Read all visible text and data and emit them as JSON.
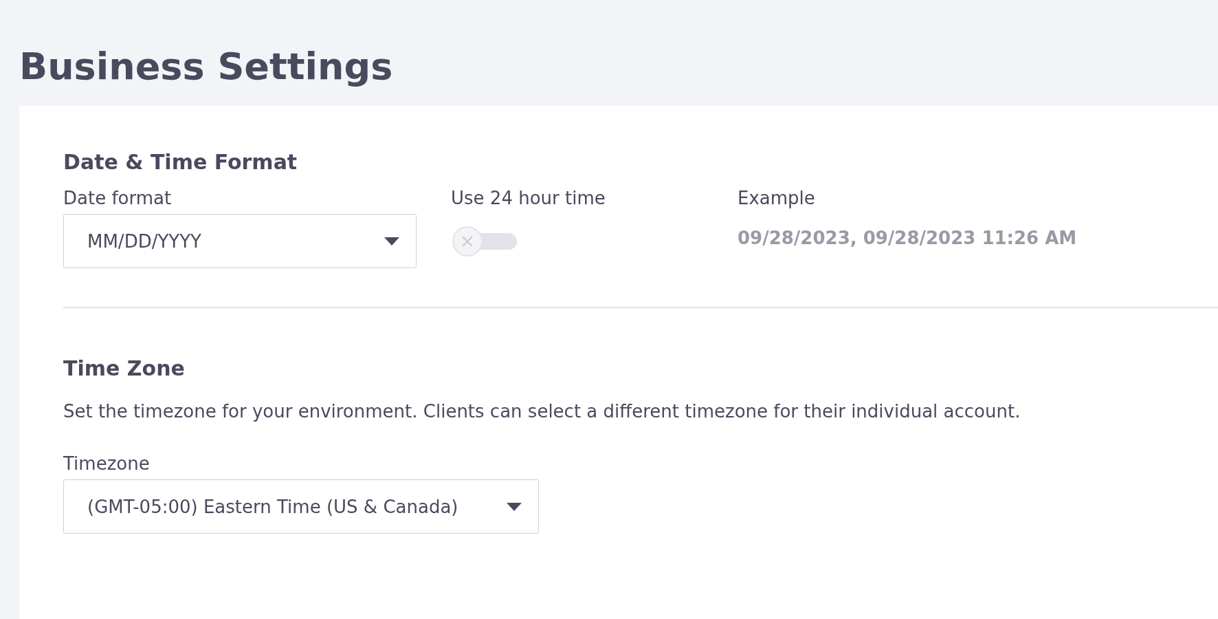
{
  "page_title": "Business Settings",
  "date_time_section": {
    "heading": "Date & Time Format",
    "date_format": {
      "label": "Date format",
      "value": "MM/DD/YYYY"
    },
    "use_24_hour": {
      "label": "Use 24 hour time",
      "on": false
    },
    "example": {
      "label": "Example",
      "value": "09/28/2023, 09/28/2023 11:26 AM"
    }
  },
  "time_zone_section": {
    "heading": "Time Zone",
    "description": "Set the timezone for your environment. Clients can select a different timezone for their individual account.",
    "timezone": {
      "label": "Timezone",
      "value": "(GMT-05:00) Eastern Time (US & Canada)"
    }
  }
}
